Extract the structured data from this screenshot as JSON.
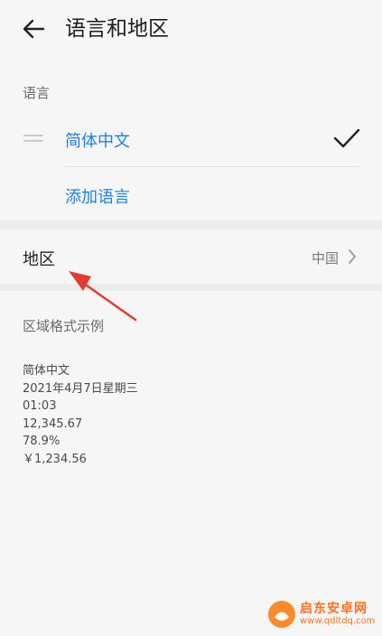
{
  "header": {
    "title": "语言和地区",
    "back_icon": "arrow-left-icon"
  },
  "language_section": {
    "label": "语言",
    "items": [
      {
        "name": "简体中文",
        "selected": true
      }
    ],
    "add_label": "添加语言"
  },
  "region": {
    "label": "地区",
    "value": "中国"
  },
  "format_sample": {
    "title": "区域格式示例",
    "lines": [
      "简体中文",
      "2021年4月7日星期三",
      "01:03",
      "12,345.67",
      "78.9%",
      "￥1,234.56"
    ]
  },
  "watermark": {
    "name": "启东安卓网",
    "url": "www.qdltdq.com"
  },
  "colors": {
    "accent": "#1f7fe6",
    "annotation_arrow": "#e23b32",
    "watermark": "#ff6f1f"
  }
}
